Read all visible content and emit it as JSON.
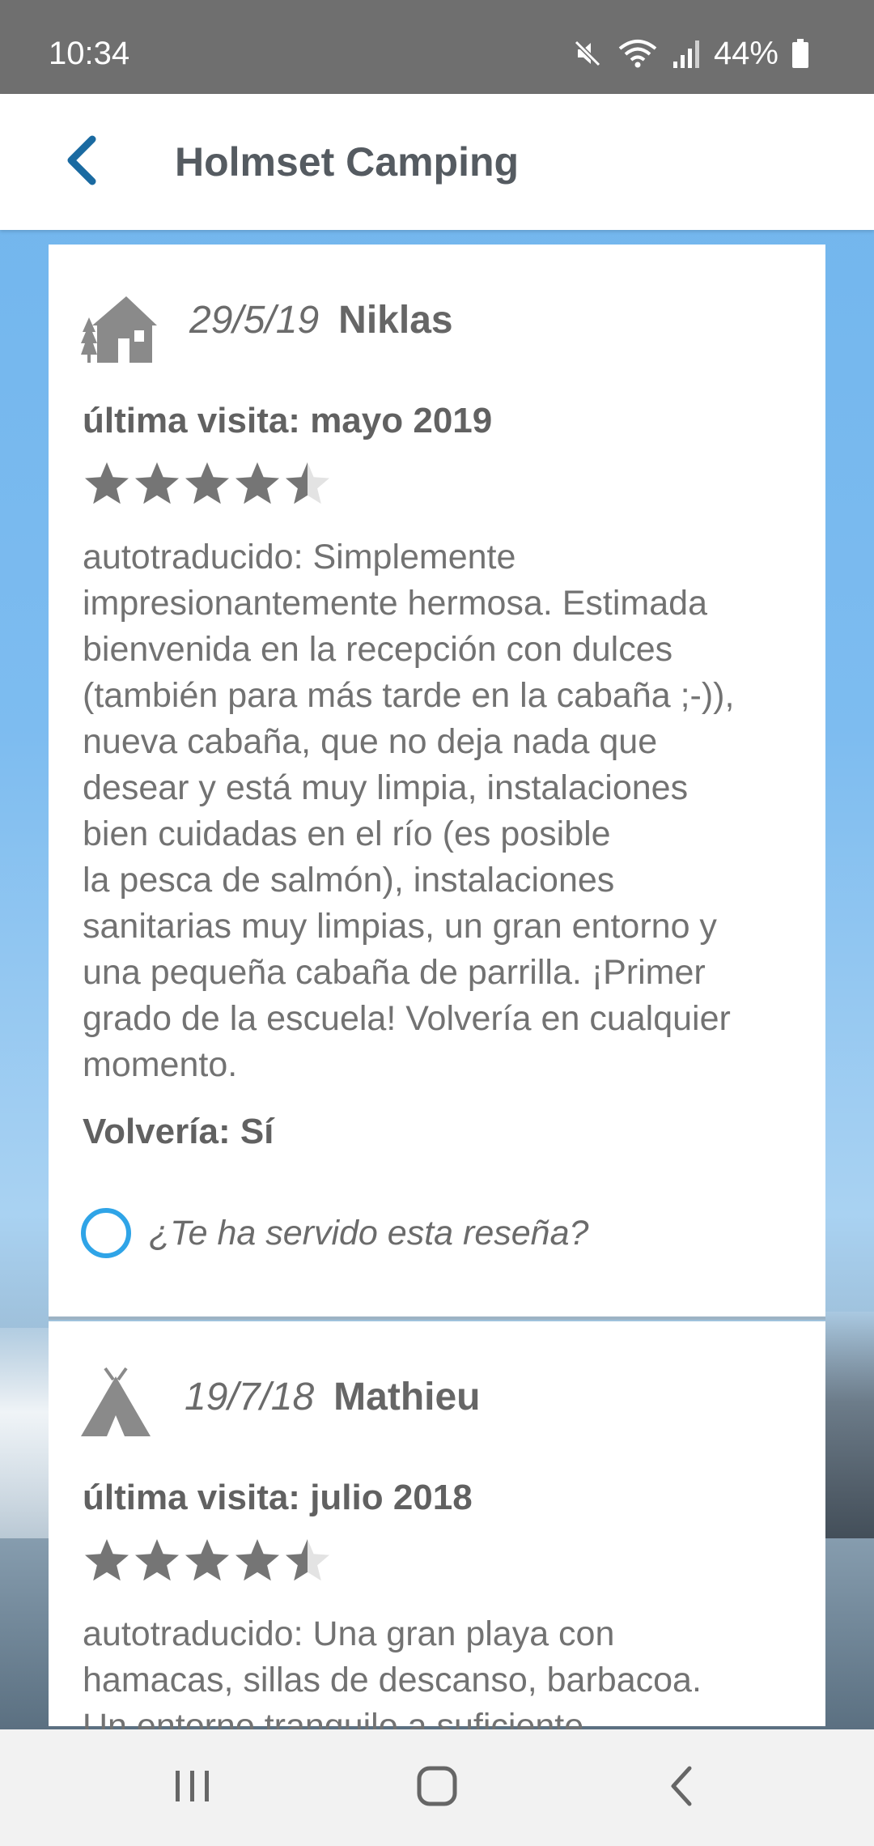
{
  "status_bar": {
    "time": "10:34",
    "battery_percent": "44%",
    "icons": [
      "mute-icon",
      "wifi-icon",
      "signal-icon",
      "battery-icon"
    ]
  },
  "app_bar": {
    "title": "Holmset Camping",
    "back_icon": "chevron-left-icon",
    "accent_color": "#1a6aa1"
  },
  "reviews": [
    {
      "type_icon": "cabin-icon",
      "date": "29/5/19",
      "author": "Niklas",
      "last_visit": "última visita: mayo 2019",
      "rating": 4.5,
      "rating_max": 5,
      "text": "autotraducido: Simplemente\nimpresionantemente hermosa. Estimada\nbienvenida en la recepción con dulces\n(también para más tarde en la cabaña ;-)),\nnueva cabaña, que no deja nada que\ndesear y está muy limpia, instalaciones\nbien cuidadas en el río (es posible\nla pesca de salmón), instalaciones\nsanitarias muy limpias, un gran entorno y\nuna pequeña cabaña de parrilla. ¡Primer\ngrado de la escuela! Volvería en cualquier\nmomento.",
      "would_return": "Volvería: Sí",
      "helpful_prompt": "¿Te ha servido esta reseña?"
    },
    {
      "type_icon": "tent-icon",
      "date": "19/7/18",
      "author": "Mathieu",
      "last_visit": "última visita: julio 2018",
      "rating": 4.5,
      "rating_max": 5,
      "text": "autotraducido: Una gran playa con\nhamacas, sillas de descanso, barbacoa.\nUn entorno tranquilo a suficiente"
    }
  ],
  "colors": {
    "star_filled": "#757575",
    "star_empty": "#e3e3e3",
    "radio_ring": "#2fa4e7",
    "status_bar_bg": "#6f6f6f"
  },
  "nav_bar": {
    "icons": [
      "recent-apps-icon",
      "home-icon",
      "back-icon"
    ]
  }
}
